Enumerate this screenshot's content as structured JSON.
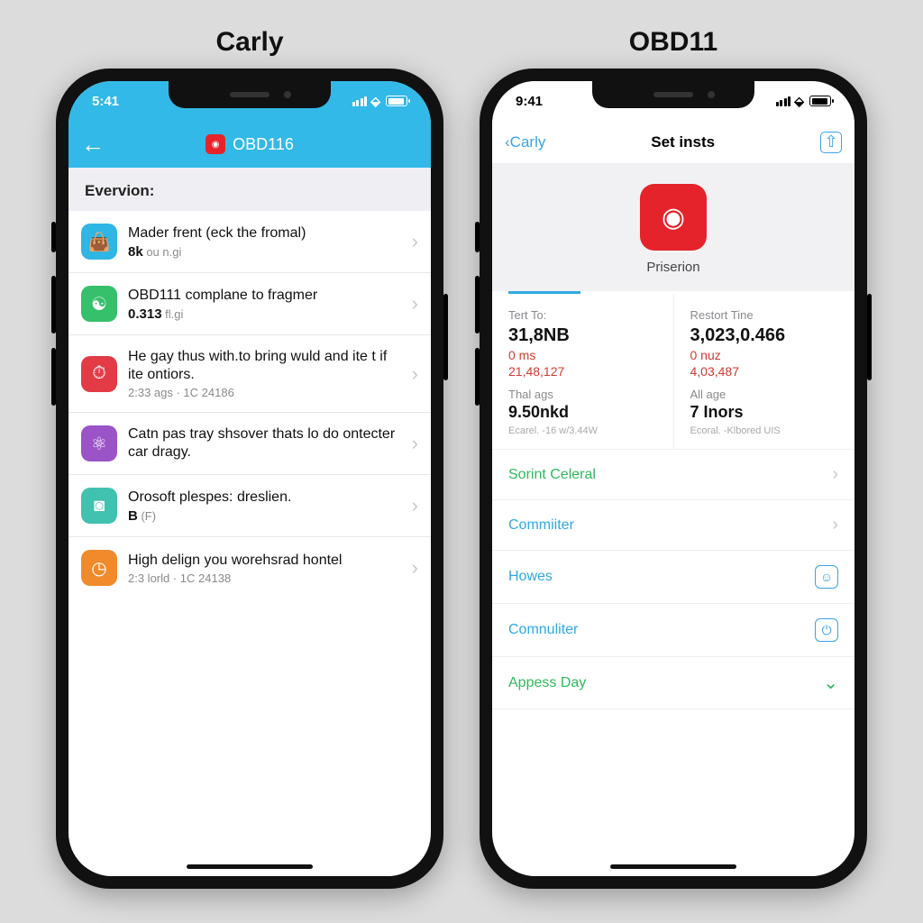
{
  "columns": {
    "left_title": "Carly",
    "right_title": "OBD11"
  },
  "left": {
    "status_time": "5:41",
    "nav_title": "OBD116",
    "section_label": "Evervion:",
    "rows": [
      {
        "title": "Mader frent (eck the fromal)",
        "sub_val": "8k",
        "sub_unit": "ou n.gi",
        "icon": "bag-icon",
        "color": "ic-blue"
      },
      {
        "title": "OBD111 complane to fragmer",
        "sub_val": "0.313",
        "sub_unit": "fl.gi",
        "icon": "gauge-icon",
        "color": "ic-green"
      },
      {
        "title": "He gay thus with.to bring wuld and ite t if ite ontiors.",
        "meta": "2:33 ags · 1C 24186",
        "icon": "tachometer-icon",
        "color": "ic-red"
      },
      {
        "title": "Catn pas tray shsover thats lo do ontecter car dragy.",
        "icon": "molecule-icon",
        "color": "ic-purple"
      },
      {
        "title": "Orosoft plespes: dreslien.",
        "sub_val": "B",
        "sub_unit": "(F)",
        "icon": "camera-icon",
        "color": "ic-teal"
      },
      {
        "title": "High delign you worehsrad hontel",
        "meta": "2:3 lorld · 1C 24138",
        "icon": "clock-icon",
        "color": "ic-orange"
      }
    ]
  },
  "right": {
    "status_time": "9:41",
    "back_label": "Carly",
    "nav_title": "Set insts",
    "hero_caption": "Priserion",
    "stats": {
      "left": {
        "label": "Tert To:",
        "main": "31,8NB",
        "red1": "0 ms",
        "red2": "21,48,127",
        "sub_label": "Thal ags",
        "main2": "9.50nkd",
        "foot": "Ecarel. -16  w/3.44W"
      },
      "right": {
        "label": "Restort Tine",
        "main": "3,023,0.466",
        "red1": "0 nuz",
        "red2": "4,03,487",
        "sub_label": "All age",
        "main2": "7 Inors",
        "foot": "Ecoral. -Klbored UIS"
      }
    },
    "links": [
      {
        "label": "Sorint Celeral",
        "style": "lr-green",
        "end": "chev"
      },
      {
        "label": "Commiiter",
        "style": "lr-blue",
        "end": "chev"
      },
      {
        "label": "Howes",
        "style": "lr-blue",
        "end": "person"
      },
      {
        "label": "Comnuliter",
        "style": "lr-blue",
        "end": "power"
      },
      {
        "label": "Appess Day",
        "style": "lr-green2",
        "end": "down"
      }
    ]
  }
}
